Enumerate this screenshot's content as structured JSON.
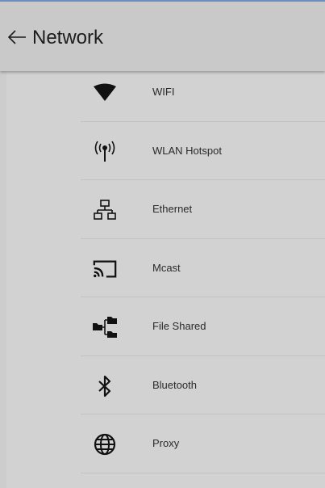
{
  "header": {
    "title": "Network",
    "back_icon": "back-arrow-icon"
  },
  "menu": {
    "items": [
      {
        "label": "WIFI",
        "icon": "wifi-icon"
      },
      {
        "label": "WLAN Hotspot",
        "icon": "hotspot-icon"
      },
      {
        "label": "Ethernet",
        "icon": "ethernet-icon"
      },
      {
        "label": "Mcast",
        "icon": "cast-icon"
      },
      {
        "label": "File Shared",
        "icon": "file-shared-icon"
      },
      {
        "label": "Bluetooth",
        "icon": "bluetooth-icon"
      },
      {
        "label": "Proxy",
        "icon": "globe-icon"
      }
    ]
  }
}
